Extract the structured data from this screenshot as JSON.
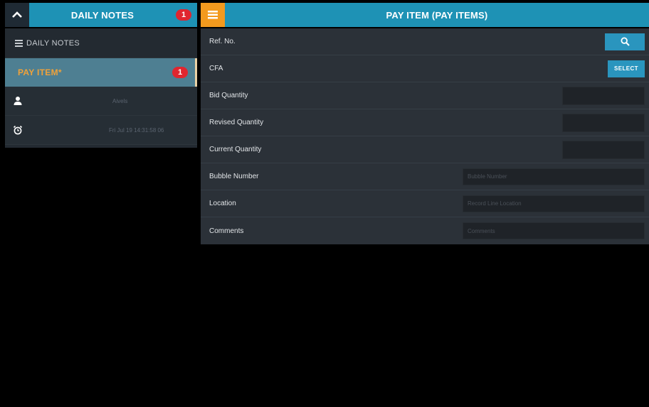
{
  "left_header": {
    "title": "DAILY NOTES",
    "badge": "1"
  },
  "right_header": {
    "title": "PAY ITEM (PAY ITEMS)"
  },
  "left_panel": {
    "section_label": "DAILY NOTES",
    "active_item": {
      "label": "PAY ITEM*",
      "badge": "1"
    },
    "rows": [
      {
        "icon": "person-icon",
        "value": "Aivels"
      },
      {
        "icon": "alarm-clock-icon",
        "value": "Fri Jul 19 14:31:58 06"
      }
    ]
  },
  "form": {
    "ref_no": {
      "label": "Ref. No."
    },
    "cfa": {
      "label": "CFA",
      "button": "SELECT"
    },
    "bid_quantity": {
      "label": "Bid Quantity"
    },
    "revised_quantity": {
      "label": "Revised Quantity"
    },
    "current_quantity": {
      "label": "Current Quantity"
    },
    "bubble_number": {
      "label": "Bubble Number",
      "placeholder": "Bubble Number"
    },
    "location": {
      "label": "Location",
      "placeholder": "Record Line Location"
    },
    "comments": {
      "label": "Comments",
      "placeholder": "Comments"
    }
  },
  "colors": {
    "accent": "#1e92b5",
    "menu": "#f39a1e",
    "badge": "#e0262f"
  }
}
